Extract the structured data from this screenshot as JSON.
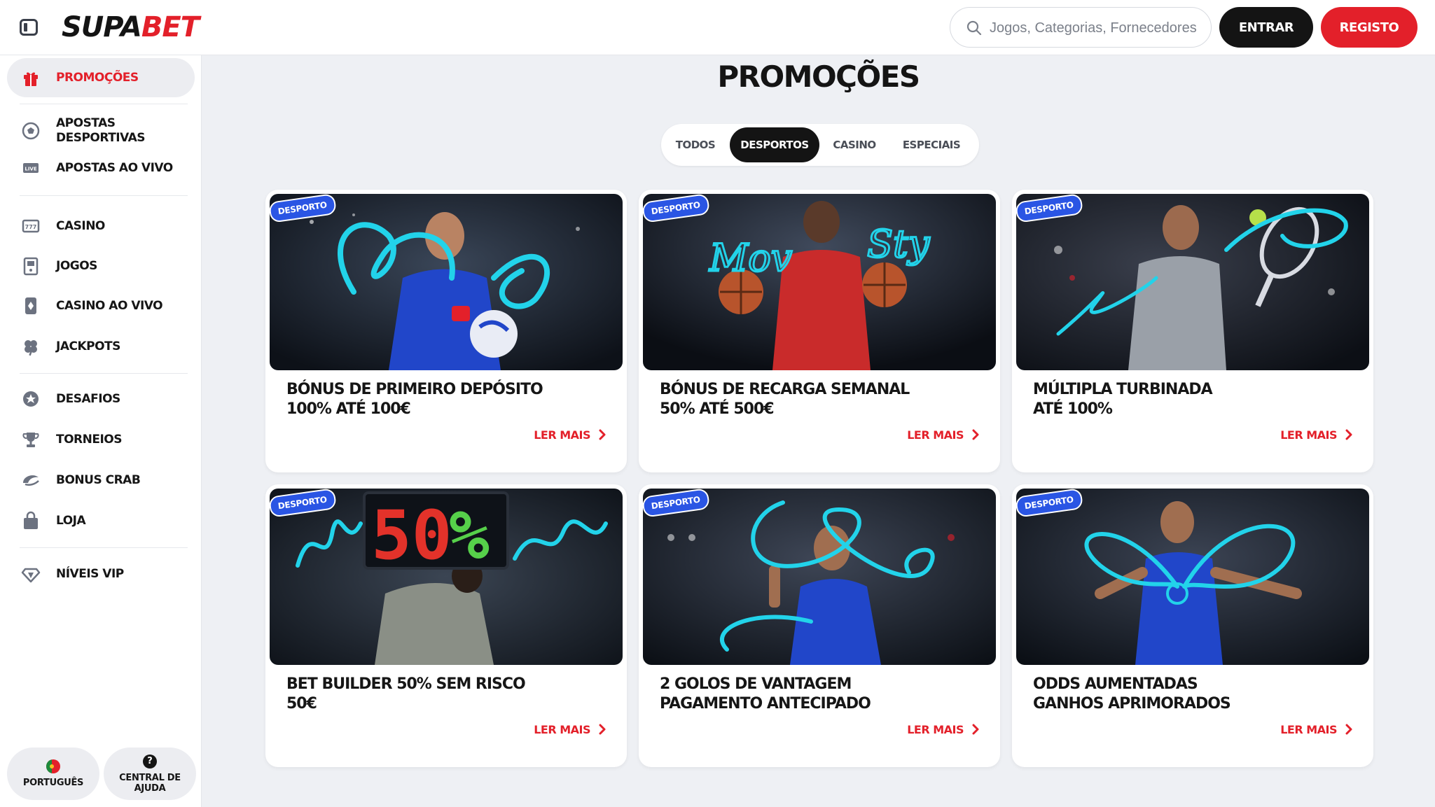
{
  "brand": {
    "logo_part1": "SUPA",
    "logo_part2": "BET",
    "accent": "#e3202a",
    "dark": "#141414",
    "badge_blue": "#2a55e4"
  },
  "header": {
    "search_placeholder": "Jogos, Categorias, Fornecedores",
    "login_label": "ENTRAR",
    "register_label": "REGISTO"
  },
  "sidebar": {
    "items": [
      {
        "label": "PROMOÇÕES",
        "icon": "gift-icon",
        "active": true
      },
      {
        "label": "APOSTAS DESPORTIVAS",
        "icon": "soccer-ball-icon"
      },
      {
        "label": "APOSTAS AO VIVO",
        "icon": "live-icon"
      },
      {
        "label": "CASINO",
        "icon": "slot-machine-icon"
      },
      {
        "label": "JOGOS",
        "icon": "arcade-icon"
      },
      {
        "label": "CASINO AO VIVO",
        "icon": "card-icon"
      },
      {
        "label": "JACKPOTS",
        "icon": "clover-icon"
      },
      {
        "label": "DESAFIOS",
        "icon": "medal-icon"
      },
      {
        "label": "TORNEIOS",
        "icon": "trophy-icon"
      },
      {
        "label": "BONUS CRAB",
        "icon": "crab-icon"
      },
      {
        "label": "LOJA",
        "icon": "shopping-bag-icon"
      },
      {
        "label": "NÍVEIS VIP",
        "icon": "diamond-icon"
      }
    ],
    "language_label": "PORTUGUÊS",
    "help_label": "CENTRAL DE AJUDA"
  },
  "main": {
    "title": "PROMOÇÕES",
    "tabs": [
      {
        "label": "TODOS",
        "active": false
      },
      {
        "label": "DESPORTOS",
        "active": true
      },
      {
        "label": "CASINO",
        "active": false
      },
      {
        "label": "ESPECIAIS",
        "active": false
      }
    ],
    "cards": [
      {
        "badge": "DESPORTO",
        "title_line1": "BÓNUS DE PRIMEIRO DEPÓSITO",
        "title_line2": "100% ATÉ 100€",
        "cta": "LER MAIS",
        "scene": "soccer-player"
      },
      {
        "badge": "DESPORTO",
        "title_line1": "BÓNUS DE RECARGA SEMANAL",
        "title_line2": "50% ATÉ 500€",
        "cta": "LER MAIS",
        "scene": "basketball-player",
        "art_text1": "Mov",
        "art_text2": "Sty"
      },
      {
        "badge": "DESPORTO",
        "title_line1": "MÚLTIPLA TURBINADA",
        "title_line2": "ATÉ 100%",
        "cta": "LER MAIS",
        "scene": "tennis-player"
      },
      {
        "badge": "DESPORTO",
        "title_line1": "BET BUILDER 50% SEM RISCO",
        "title_line2": "50€",
        "cta": "LER MAIS",
        "scene": "substitution-board",
        "board_text_a": "50",
        "board_text_b": "%"
      },
      {
        "badge": "DESPORTO",
        "title_line1": "2 GOLOS DE VANTAGEM",
        "title_line2": "PAGAMENTO ANTECIPADO",
        "cta": "LER MAIS",
        "scene": "two-fingers-player"
      },
      {
        "badge": "DESPORTO",
        "title_line1": "ODDS AUMENTADAS",
        "title_line2": "GANHOS APRIMORADOS",
        "cta": "LER MAIS",
        "scene": "celebrating-player"
      }
    ]
  }
}
